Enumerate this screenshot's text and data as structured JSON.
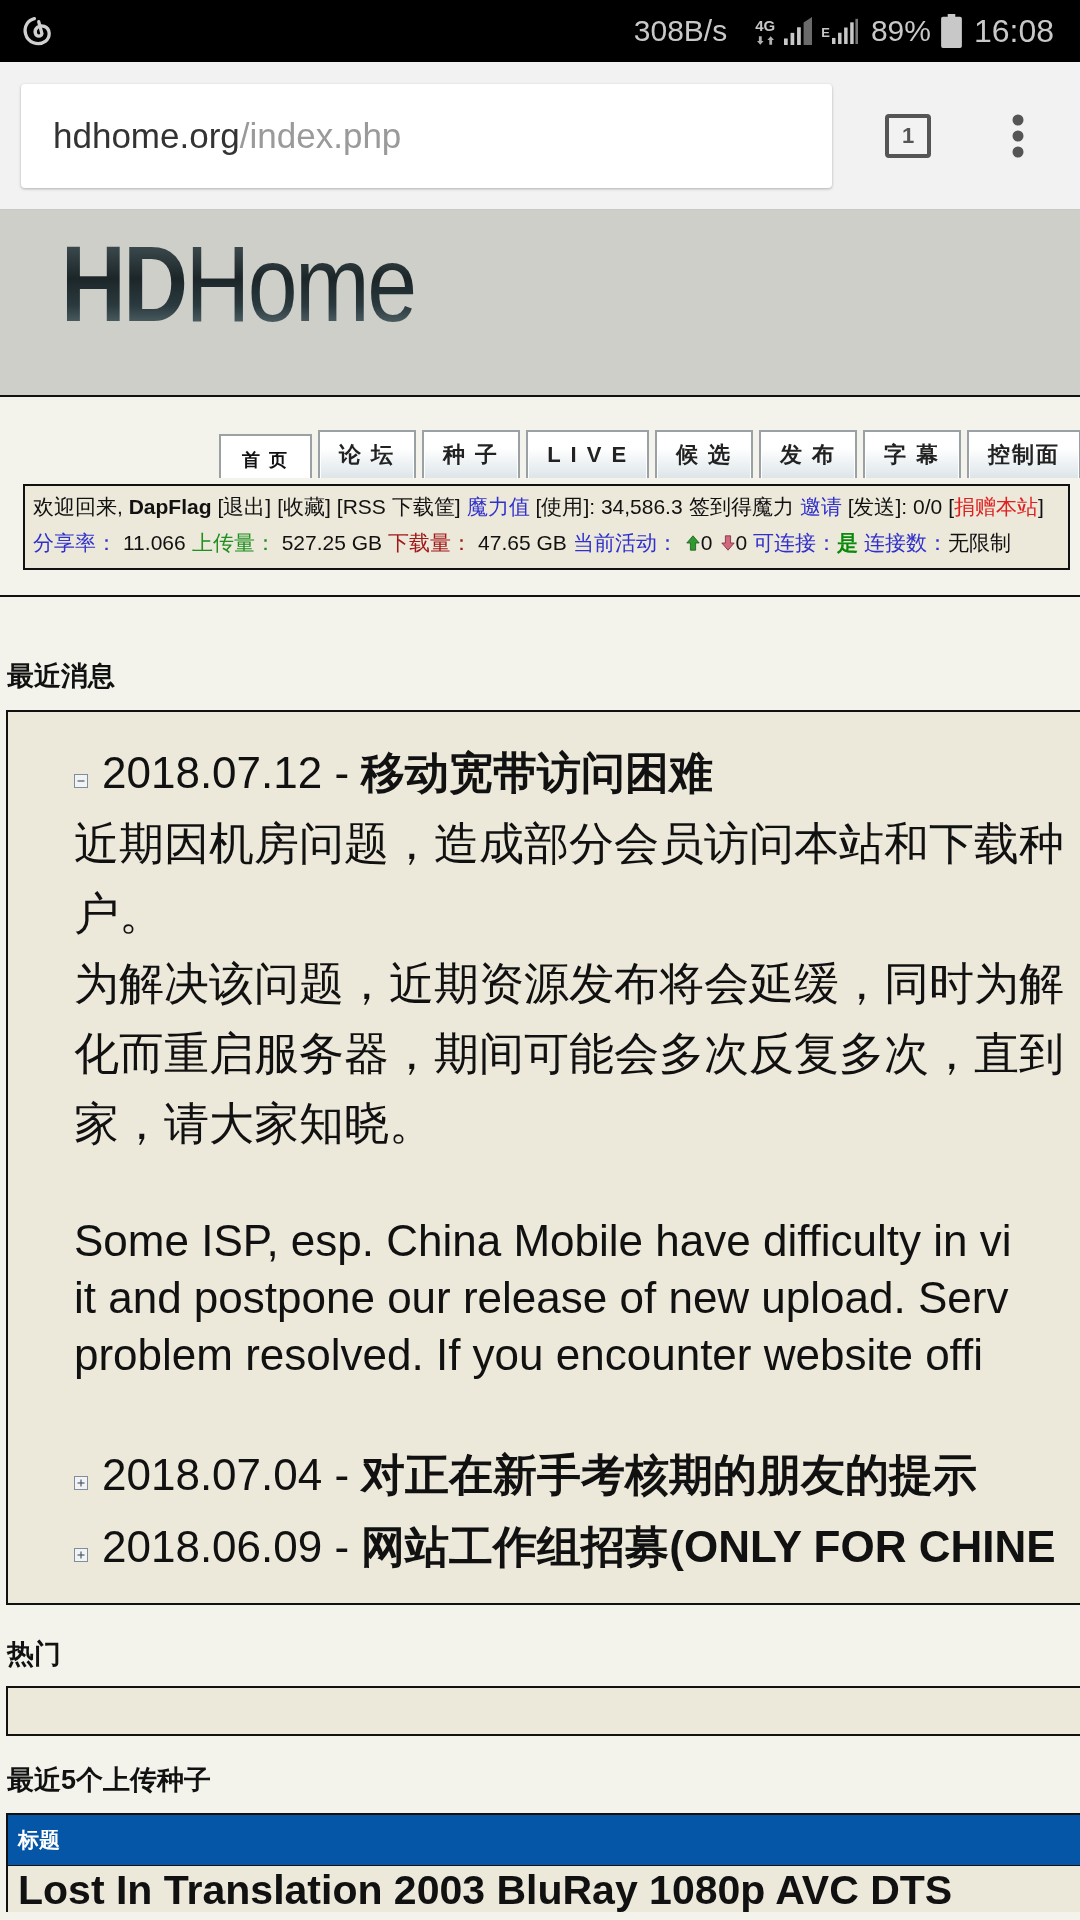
{
  "status_bar": {
    "network_speed": "308B/s",
    "network_type": "4G",
    "second_network_type": "E",
    "battery": "89%",
    "time": "16:08"
  },
  "browser": {
    "url_host": "hdhome.org",
    "url_path": "/index.php",
    "tab_count": "1"
  },
  "site_header": {
    "logo": "**HD**Home"
  },
  "nav_tabs": [
    {
      "label": "首 页",
      "selected": true
    },
    {
      "label": "论 坛",
      "selected": false
    },
    {
      "label": "种 子",
      "selected": false
    },
    {
      "label": "L I V E",
      "selected": false
    },
    {
      "label": "候 选",
      "selected": false
    },
    {
      "label": "发 布",
      "selected": false
    },
    {
      "label": "字 幕",
      "selected": false
    },
    {
      "label": "控制面",
      "selected": false
    }
  ],
  "user_bar": {
    "lines": [
      [
        [
          {
            "kind": "text",
            "text": "欢迎回来, **DapFlag**"
          }
        ],
        [
          {
            "kind": "link",
            "text": "[退出]"
          }
        ],
        [
          {
            "kind": "link",
            "text": "[收藏]"
          }
        ],
        [
          {
            "kind": "link",
            "text": "[RSS 下载筐]"
          }
        ],
        [
          {
            "kind": "link",
            "text": "魔力值",
            "color": "#3030cc"
          }
        ],
        [
          {
            "kind": "link",
            "text": "[使用]"
          },
          {
            "kind": "value",
            "text": ": 34,586.3"
          }
        ],
        [
          {
            "kind": "link",
            "text": "签到得魔力"
          }
        ],
        [
          {
            "kind": "link",
            "text": "邀请",
            "color": "#3030cc"
          }
        ],
        [
          {
            "kind": "link",
            "text": "[发送]"
          },
          {
            "kind": "value",
            "text": ": 0/0"
          }
        ],
        [
          {
            "kind": "link",
            "before": "[",
            "text": "捐赠本站",
            "after": "]",
            "color": "#e02020"
          }
        ]
      ],
      [
        [
          {
            "kind": "label",
            "text": "分享率：",
            "color": "#3030cc"
          }
        ],
        [
          {
            "kind": "value",
            "text": "11.066"
          }
        ],
        [
          {
            "kind": "label",
            "text": "上传量：",
            "color": "#1f8f1f"
          }
        ],
        [
          {
            "kind": "value",
            "text": "527.25 GB"
          }
        ],
        [
          {
            "kind": "label",
            "text": "下载量：",
            "color": "#a01818"
          }
        ],
        [
          {
            "kind": "value",
            "text": "47.65 GB"
          }
        ],
        [
          {
            "kind": "label",
            "text": "当前活动：",
            "color": "#3030cc"
          }
        ],
        [
          {
            "kind": "seeding",
            "text": "0"
          }
        ],
        [
          {
            "kind": "leeching",
            "text": "0"
          }
        ],
        [
          {
            "kind": "label",
            "text": "可连接：",
            "color": "#3030cc"
          },
          {
            "kind": "flag",
            "text": "是",
            "color": "#0a8a0a"
          }
        ],
        [
          {
            "kind": "label",
            "text": "连接数：",
            "color": "#3030cc"
          },
          {
            "kind": "value",
            "text": "无限制"
          }
        ]
      ]
    ]
  },
  "news": {
    "heading": "最近消息",
    "items": [
      {
        "title": "2018.07.12 - **移动宽带访问困难**",
        "expanded": true,
        "paragraphs": [
          {
            "kind": "cjk",
            "lines": [
              "近期因机房问题，造成部分会员访问本站和下载种",
              "户。"
            ]
          },
          {
            "kind": "cjk",
            "lines": [
              "为解决该问题，近期资源发布将会延缓，同时为解",
              "化而重启服务器，期间可能会多次反复多次，直到",
              "家，请大家知晓。"
            ]
          },
          {
            "kind": "latin",
            "lines": [
              "Some ISP, esp. China Mobile have difficulty in vi",
              "it and postpone our release of new upload. Serv",
              "problem resolved. If you encounter website offi"
            ]
          }
        ]
      },
      {
        "title": "2018.07.04 - **对正在新手考核期的朋友的提示**",
        "expanded": false
      },
      {
        "title": "2018.06.09 - **网站工作组招募(ONLY FOR CHINE**",
        "expanded": false
      }
    ]
  },
  "hot": {
    "heading": "热门"
  },
  "latest_torrents": {
    "heading": "最近5个上传种子",
    "columns": [
      "标题"
    ],
    "rows": [
      {
        "title": "Lost In Translation 2003 BluRay 1080p AVC DTS"
      }
    ]
  }
}
